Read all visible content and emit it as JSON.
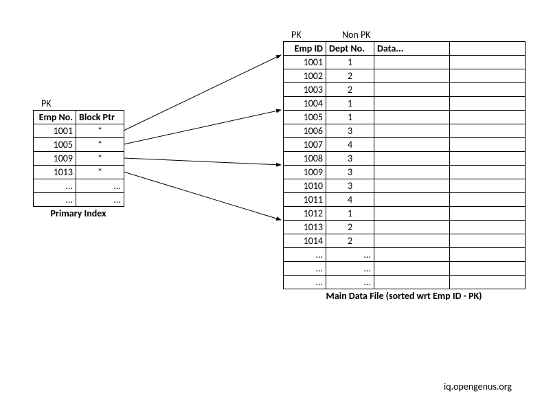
{
  "index_table": {
    "pk_label": "PK",
    "header": {
      "col1": "Emp No.",
      "col2": "Block Ptr"
    },
    "rows": [
      {
        "empno": "1001",
        "ptr": "*"
      },
      {
        "empno": "1005",
        "ptr": "*"
      },
      {
        "empno": "1009",
        "ptr": "*"
      },
      {
        "empno": "1013",
        "ptr": "*"
      },
      {
        "empno": "...",
        "ptr": "..."
      },
      {
        "empno": "...",
        "ptr": "..."
      }
    ],
    "caption": "Primary Index"
  },
  "data_table": {
    "pk_label": "PK",
    "nonpk_label": "Non PK",
    "header": {
      "col1": "Emp ID",
      "col2": "Dept No.",
      "col3": "Data...",
      "col4": ""
    },
    "rows": [
      {
        "empid": "1001",
        "dept": "1"
      },
      {
        "empid": "1002",
        "dept": "2"
      },
      {
        "empid": "1003",
        "dept": "2"
      },
      {
        "empid": "1004",
        "dept": "1"
      },
      {
        "empid": "1005",
        "dept": "1"
      },
      {
        "empid": "1006",
        "dept": "3"
      },
      {
        "empid": "1007",
        "dept": "4"
      },
      {
        "empid": "1008",
        "dept": "3"
      },
      {
        "empid": "1009",
        "dept": "3"
      },
      {
        "empid": "1010",
        "dept": "3"
      },
      {
        "empid": "1011",
        "dept": "4"
      },
      {
        "empid": "1012",
        "dept": "1"
      },
      {
        "empid": "1013",
        "dept": "2"
      },
      {
        "empid": "1014",
        "dept": "2"
      },
      {
        "empid": "...",
        "dept": "..."
      },
      {
        "empid": "...",
        "dept": "..."
      },
      {
        "empid": "...",
        "dept": "..."
      }
    ],
    "caption": "Main Data File (sorted wrt Emp ID - PK)"
  },
  "footer": "iq.opengenus.org"
}
